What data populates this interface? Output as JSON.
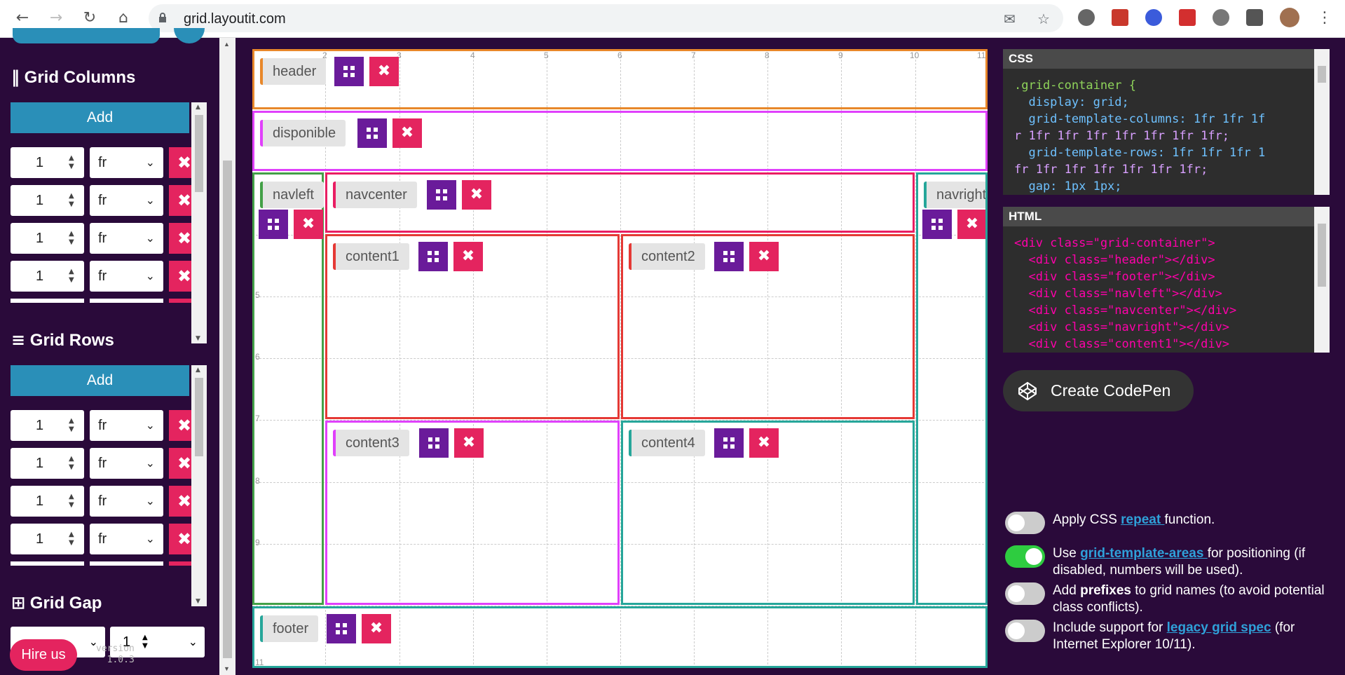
{
  "browser": {
    "url": "grid.layoutit.com"
  },
  "sidebar": {
    "columns_title": "Grid Columns",
    "rows_title": "Grid Rows",
    "gap_title": "Grid Gap",
    "add_label": "Add",
    "col_rows": [
      {
        "value": "1",
        "unit": "fr"
      },
      {
        "value": "1",
        "unit": "fr"
      },
      {
        "value": "1",
        "unit": "fr"
      },
      {
        "value": "1",
        "unit": "fr"
      }
    ],
    "row_rows": [
      {
        "value": "1",
        "unit": "fr"
      },
      {
        "value": "1",
        "unit": "fr"
      },
      {
        "value": "1",
        "unit": "fr"
      },
      {
        "value": "1",
        "unit": "fr"
      }
    ],
    "gap_row_value": "1",
    "hire_label": "Hire us",
    "version_label": "version",
    "version": "1.0.3"
  },
  "grid": {
    "col_numbers": [
      "2",
      "3",
      "4",
      "5",
      "6",
      "7",
      "8",
      "9",
      "10",
      "11"
    ],
    "row_numbers": [
      "5",
      "6",
      "7",
      "8",
      "9",
      "11"
    ],
    "areas": {
      "header": "header",
      "disponible": "disponible",
      "navleft": "navleft",
      "navcenter": "navcenter",
      "navright": "navright",
      "content1": "content1",
      "content2": "content2",
      "content3": "content3",
      "content4": "content4",
      "footer": "footer"
    }
  },
  "css_panel": {
    "title": "CSS",
    "lines": [
      ".grid-container {",
      "  display: grid;",
      "  grid-template-columns: 1fr 1fr 1f",
      "r 1fr 1fr 1fr 1fr 1fr 1fr 1fr;",
      "  grid-template-rows: 1fr 1fr 1fr 1",
      "fr 1fr 1fr 1fr 1fr 1fr 1fr;",
      "  gap: 1px 1px;"
    ]
  },
  "html_panel": {
    "title": "HTML",
    "lines": [
      "<div class=\"grid-container\">",
      "  <div class=\"header\"></div>",
      "  <div class=\"footer\"></div>",
      "  <div class=\"navleft\"></div>",
      "  <div class=\"navcenter\"></div>",
      "  <div class=\"navright\"></div>",
      "  <div class=\"content1\"></div>"
    ]
  },
  "codepen_label": "Create CodePen",
  "options": {
    "repeat": {
      "a": "Apply CSS ",
      "link": "repeat ",
      "b": "function."
    },
    "areas": {
      "a": "Use ",
      "link": "grid-template-areas ",
      "b": "for positioning (if disabled, numbers will be used)."
    },
    "prefixes": {
      "a": "Add ",
      "bold": "prefixes",
      "b": " to grid names (to avoid potential class conflicts)."
    },
    "legacy": {
      "a": "Include support for ",
      "link": "legacy grid spec",
      "b": " (for Internet Explorer 10/11)."
    }
  }
}
